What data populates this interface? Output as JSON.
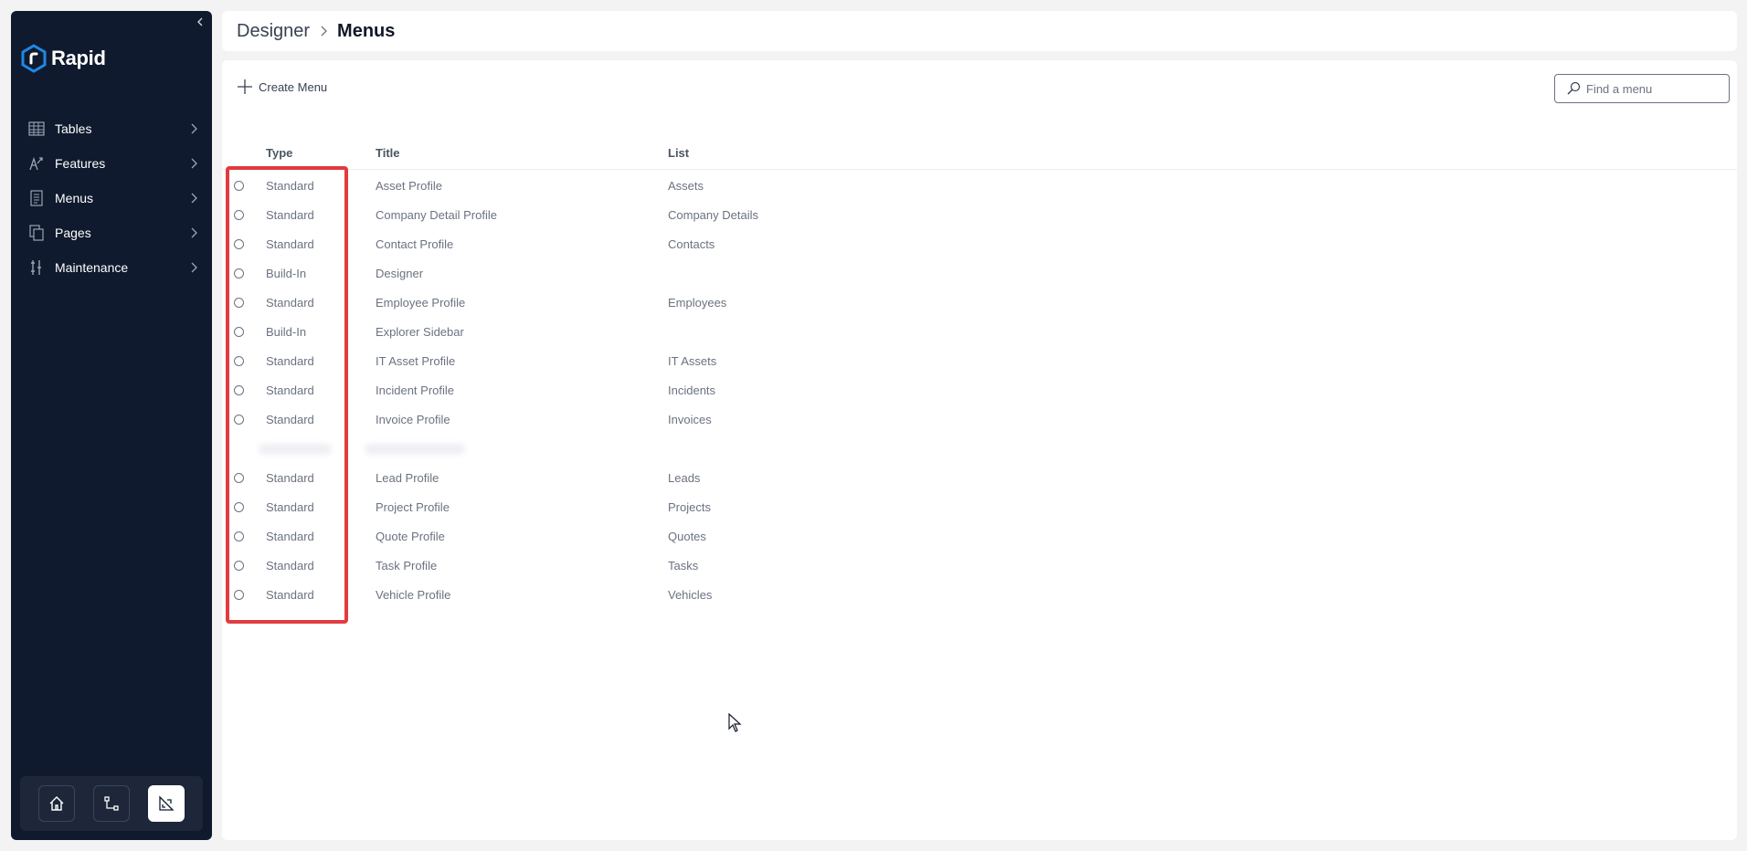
{
  "app": {
    "name": "Rapid"
  },
  "sidebar": {
    "items": [
      {
        "label": "Tables",
        "icon": "table-icon"
      },
      {
        "label": "Features",
        "icon": "features-icon"
      },
      {
        "label": "Menus",
        "icon": "menu-icon"
      },
      {
        "label": "Pages",
        "icon": "pages-icon"
      },
      {
        "label": "Maintenance",
        "icon": "maintenance-icon"
      }
    ],
    "footer": [
      "home-icon",
      "flow-icon",
      "designer-icon"
    ],
    "active_footer": "designer-icon"
  },
  "breadcrumb": {
    "parent": "Designer",
    "current": "Menus"
  },
  "toolbar": {
    "create_label": "Create Menu",
    "search_placeholder": "Find a menu"
  },
  "table": {
    "columns": {
      "type": "Type",
      "title": "Title",
      "list": "List"
    },
    "rows": [
      {
        "type": "Standard",
        "title": "Asset Profile",
        "list": "Assets"
      },
      {
        "type": "Standard",
        "title": "Company Detail Profile",
        "list": "Company Details"
      },
      {
        "type": "Standard",
        "title": "Contact Profile",
        "list": "Contacts"
      },
      {
        "type": "Build-In",
        "title": "Designer",
        "list": ""
      },
      {
        "type": "Standard",
        "title": "Employee Profile",
        "list": "Employees"
      },
      {
        "type": "Build-In",
        "title": "Explorer Sidebar",
        "list": ""
      },
      {
        "type": "Standard",
        "title": "IT Asset Profile",
        "list": "IT Assets"
      },
      {
        "type": "Standard",
        "title": "Incident Profile",
        "list": "Incidents"
      },
      {
        "type": "Standard",
        "title": "Invoice Profile",
        "list": "Invoices"
      },
      {
        "type": "",
        "title": "",
        "list": "",
        "blurred": true
      },
      {
        "type": "Standard",
        "title": "Lead Profile",
        "list": "Leads"
      },
      {
        "type": "Standard",
        "title": "Project Profile",
        "list": "Projects"
      },
      {
        "type": "Standard",
        "title": "Quote Profile",
        "list": "Quotes"
      },
      {
        "type": "Standard",
        "title": "Task Profile",
        "list": "Tasks"
      },
      {
        "type": "Standard",
        "title": "Vehicle Profile",
        "list": "Vehicles"
      }
    ]
  },
  "colors": {
    "sidebar_bg": "#0f1a2e",
    "accent": "#1e88e5",
    "highlight": "#e23b3f"
  }
}
